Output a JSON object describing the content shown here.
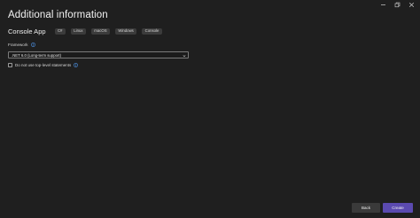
{
  "dialog": {
    "title": "Additional information"
  },
  "window_controls": {
    "icons": [
      "minimize-icon",
      "restore-icon",
      "close-icon"
    ]
  },
  "template": {
    "name": "Console App",
    "tags": [
      "C#",
      "Linux",
      "macOS",
      "Windows",
      "Console"
    ]
  },
  "framework": {
    "label": "Framework",
    "selected": ".NET 6.0 (Long-term support)"
  },
  "top_level_statements": {
    "label": "Do not use top-level statements",
    "checked": false
  },
  "footer": {
    "back_label": "Back",
    "create_label": "Create"
  },
  "colors": {
    "background": "#1f1f1f",
    "primary_button": "#5b4ab0",
    "secondary_button": "#3a3a3a",
    "info_icon": "#4c8fe0"
  }
}
